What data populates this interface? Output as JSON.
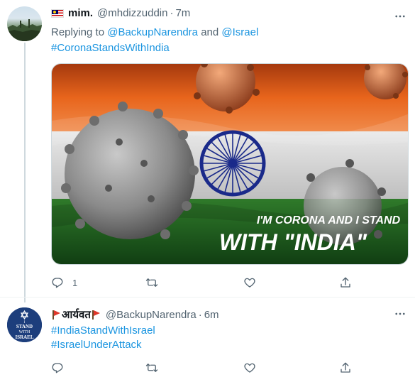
{
  "tweets": [
    {
      "name": "mim.",
      "handle": "@mhdizzuddin",
      "separator": "·",
      "time": "7m",
      "replying_prefix": "Replying to",
      "replying_user1": "@BackupNarendra",
      "replying_and": "and",
      "replying_user2": "@Israel",
      "hashtag": "#CoronaStandsWithIndia",
      "image_caption_line1": "I'M CORONA AND I STAND",
      "image_caption_line2": "WITH \"INDIA\"",
      "reply_count": "1"
    },
    {
      "name": "आर्यवत",
      "handle": "@BackupNarendra",
      "separator": "·",
      "time": "6m",
      "hashtag1": "#IndiaStandWithIsrael",
      "hashtag2": "#IsraelUnderAttack",
      "avatar_text": [
        "I",
        "STAND",
        "WITH",
        "ISRAEL"
      ]
    }
  ],
  "icons": [
    "reply-icon",
    "retweet-icon",
    "like-icon",
    "share-icon",
    "more-icon"
  ],
  "colors": {
    "link": "#1b95e0",
    "secondary": "#536471",
    "saffron": "#e8651c",
    "green": "#1f6b22",
    "chakra": "#1a2a8a"
  }
}
